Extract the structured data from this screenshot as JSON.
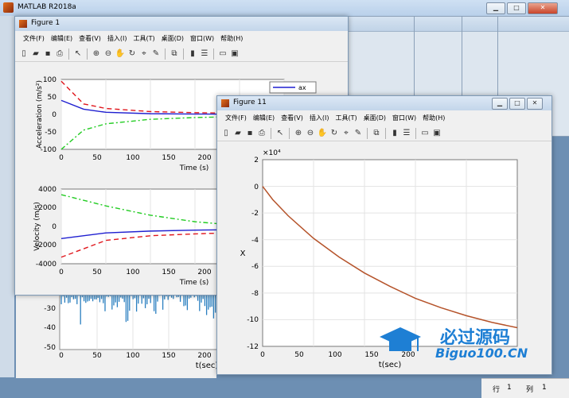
{
  "app": {
    "title": "MATLAB R2018a"
  },
  "menu": [
    "文件(F)",
    "编辑(E)",
    "查看(V)",
    "插入(I)",
    "工具(T)",
    "桌面(D)",
    "窗口(W)",
    "帮助(H)"
  ],
  "figure1": {
    "title": "Figure 1",
    "top": {
      "ylabel": "Acceleration (m/s²)",
      "xlabel": "Time (s)",
      "yticks": [
        "100",
        "50",
        "0",
        "-50",
        "-100"
      ],
      "xticks": [
        "0",
        "50",
        "100",
        "150",
        "200"
      ],
      "legend": [
        "ax"
      ]
    },
    "bottom": {
      "ylabel": "Velocity (m/s)",
      "xlabel": "Time (s)",
      "yticks": [
        "4000",
        "2000",
        "0",
        "-2000",
        "-4000"
      ],
      "xticks": [
        "0",
        "50",
        "100",
        "150",
        "200"
      ]
    }
  },
  "background_plot": {
    "yticks": [
      "-30",
      "-40",
      "-50"
    ],
    "xticks": [
      "0",
      "50",
      "100",
      "150",
      "200"
    ],
    "xlabel": "t(sec)"
  },
  "figure11": {
    "title": "Figure 11",
    "ylabel": "X",
    "xlabel": "t(sec)",
    "exponent": "×10⁴",
    "yticks": [
      "2",
      "0",
      "-2",
      "-4",
      "-6",
      "-8",
      "-10",
      "-12"
    ],
    "xticks": [
      "0",
      "50",
      "100",
      "150",
      "200"
    ]
  },
  "status": {
    "row_label": "行",
    "row": "1",
    "col_label": "列",
    "col": "1"
  },
  "watermark": {
    "cn": "必过源码",
    "url": "Biguo100.CN"
  },
  "chart_data": [
    {
      "type": "line",
      "title": "",
      "xlabel": "Time (s)",
      "ylabel": "Acceleration (m/s²)",
      "xlim": [
        0,
        250
      ],
      "ylim": [
        -100,
        100
      ],
      "series": [
        {
          "name": "ax",
          "x": [
            0,
            25,
            50,
            100,
            150,
            200,
            250
          ],
          "values": [
            40,
            15,
            6,
            2,
            1,
            0.5,
            0
          ]
        },
        {
          "x": [
            0,
            25,
            50,
            100,
            150,
            200,
            250
          ],
          "values": [
            95,
            30,
            17,
            8,
            5,
            3,
            2
          ]
        },
        {
          "x": [
            0,
            25,
            50,
            100,
            150,
            200,
            250
          ],
          "values": [
            -100,
            -45,
            -27,
            -14,
            -9,
            -6,
            -4
          ]
        }
      ]
    },
    {
      "type": "line",
      "title": "",
      "xlabel": "Time (s)",
      "ylabel": "Velocity (m/s)",
      "xlim": [
        0,
        250
      ],
      "ylim": [
        -4000,
        4000
      ],
      "series": [
        {
          "x": [
            0,
            50,
            100,
            150,
            200,
            250
          ],
          "values": [
            3400,
            2200,
            1200,
            500,
            100,
            -200
          ]
        },
        {
          "x": [
            0,
            50,
            100,
            150,
            200,
            250
          ],
          "values": [
            -1300,
            -700,
            -500,
            -400,
            -350,
            -300
          ]
        },
        {
          "x": [
            0,
            50,
            100,
            150,
            200,
            250
          ],
          "values": [
            -3300,
            -1500,
            -1000,
            -800,
            -650,
            -550
          ]
        }
      ]
    },
    {
      "type": "line",
      "title": "",
      "xlabel": "t(sec)",
      "ylabel": "X",
      "xlim": [
        0,
        250
      ],
      "ylim": [
        -12,
        2
      ],
      "series": [
        {
          "x": [
            0,
            10,
            25,
            50,
            75,
            100,
            125,
            150,
            175,
            200,
            225,
            250
          ],
          "values": [
            0,
            -1.0,
            -2.2,
            -3.9,
            -5.3,
            -6.5,
            -7.5,
            -8.4,
            -9.1,
            -9.7,
            -10.2,
            -10.6
          ]
        }
      ]
    }
  ]
}
